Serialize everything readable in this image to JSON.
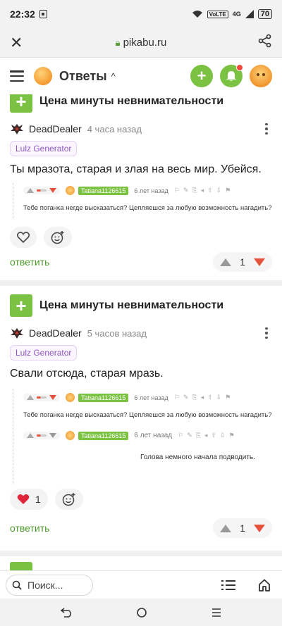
{
  "status": {
    "time": "22:32",
    "volte": "VoLTE",
    "net": "4G",
    "battery": "70"
  },
  "browser": {
    "url": "pikabu.ru"
  },
  "header": {
    "title": "Ответы"
  },
  "comments": [
    {
      "post_title": "Цена минуты невнимательности",
      "author": "DeadDealer",
      "time_ago": "4 часа назад",
      "tag": "Lulz Generator",
      "text": "Ты мразота, старая и злая на весь мир. Убейся.",
      "quotes": [
        {
          "user": "Tatiana1126615",
          "time": "6 лет назад",
          "text": "Тебе поганка негде высказаться? Цепляешся за любую возможность нагадить?"
        }
      ],
      "likes": "",
      "reply_label": "ответить",
      "rating": "1"
    },
    {
      "post_title": "Цена минуты невнимательности",
      "author": "DeadDealer",
      "time_ago": "5 часов назад",
      "tag": "Lulz Generator",
      "text": "Свали отсюда, старая мразь.",
      "quotes": [
        {
          "user": "Tatiana1126615",
          "time": "6 лет назад",
          "text": "Тебе поганка негде высказаться? Цепляешся за любую возможность нагадить?"
        },
        {
          "user": "Tatiana1126615",
          "time": "6 лет назад",
          "text": "Голова немного начала подводить."
        }
      ],
      "likes": "1",
      "reply_label": "ответить",
      "rating": "1"
    }
  ],
  "bottom": {
    "search_placeholder": "Поиск..."
  },
  "colors": {
    "green": "#7cc242",
    "red": "#e5533e",
    "purple": "#8e56c2"
  }
}
